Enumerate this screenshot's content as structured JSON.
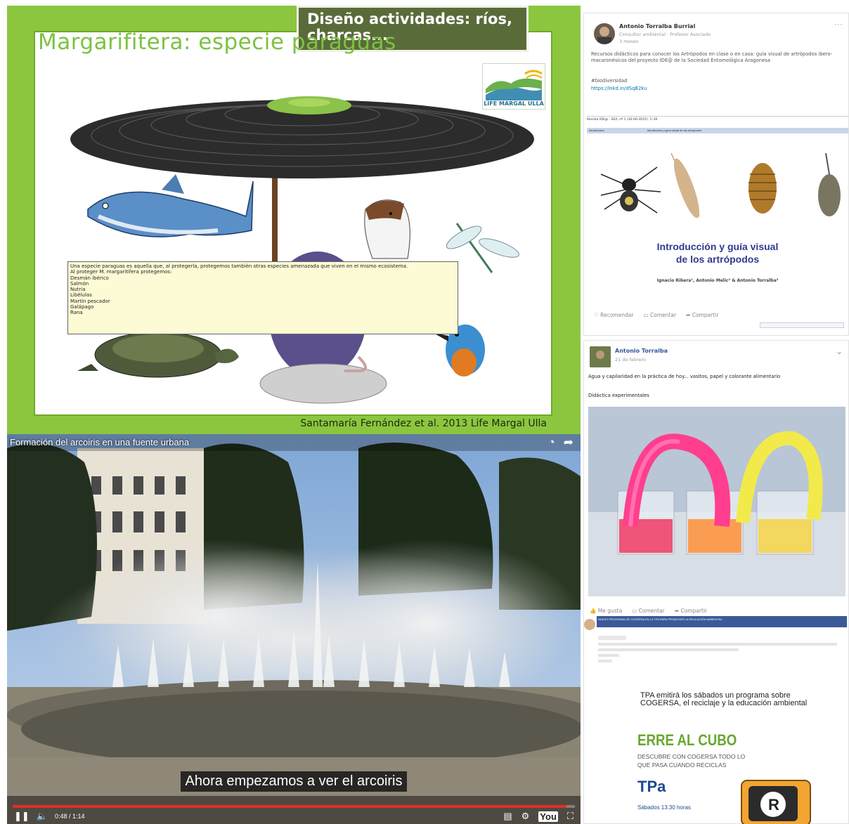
{
  "slide": {
    "banner": "Diseño actividades: ríos, charcas...",
    "title": "Margarifitera: especie paraguas",
    "logo_text": "LIFE MARGAL ULLA",
    "info_lines": [
      "Una especie paraguas es aquella que, al protegerla, protegemos también otras especies amenazada que viven en el mismo ecosistema.",
      "Al proteger M. margaritifera protegemos:",
      "Desmán ibérico",
      "Salmón",
      "Nutria",
      "Libélulas",
      "Martín pescador",
      "Galápago",
      "Rana"
    ],
    "citation": "Santamaría Fernández et al. 2013 Life Margal Ulla"
  },
  "video": {
    "title": "Formación del arcoiris en una fuente urbana",
    "subtitle": "Ahora empezamos a ver el arcoiris",
    "time": "0:48 / 1:14",
    "progress": 0.985
  },
  "card1": {
    "author": "Antonio Torralba Burrial",
    "headline": "Consultor ambiental · Profesor Asociado",
    "time": "3 meses",
    "text": "Recursos didácticos para conocer los Artrópodos en clase o en casa: guía visual de artrópodos ibero-macaronésicos del proyecto IDE@ de la Sociedad Entomológica Aragonesa",
    "hashtag": "#biodiversidad",
    "link": "https://lnkd.in/dSqB2ku",
    "doc_header": "Revista IDE@ - SEA, nº 1 (30-06-2015): 1–30",
    "doc_bar_left": "Introducción",
    "doc_bar_mid": "Introducción y guía visual de los artrópodos",
    "doc_title_1": "Introducción y guía visual",
    "doc_title_2": "de los artrópodos",
    "doc_authors": "Ignacio Ribera¹, Antonio Melic² & Antonio Torralba³",
    "action_1": "Recomendar",
    "action_2": "Comentar",
    "action_3": "Compartir"
  },
  "card2": {
    "author": "Antonio Torralba",
    "time": "21 de febrero",
    "text_1": "Agua y capilaridad en la práctica de hoy... vasitos, papel y colorante alimentario",
    "text_2": "Didáctica experimentales",
    "action_1": "Me gusta",
    "action_2": "Comentar",
    "action_3": "Compartir",
    "post_header": "NUEVO PROGRAMA DE COGERSA EN LA TPA PARA PROMOVER LA EDUCACIÓN AMBIENTAL",
    "tpa_text": "TPA emitirá los sábados un programa sobre COGERSA, el reciclaje y la educación ambiental",
    "erre": "ERRE AL CUBO",
    "descubre_1": "DESCUBRE CON COGERSA TODO LO",
    "descubre_2": "QUE PASA CUANDO RECICLAS",
    "tpa_logo": "TPa",
    "sabados": "Sábados 13:30 horas"
  }
}
